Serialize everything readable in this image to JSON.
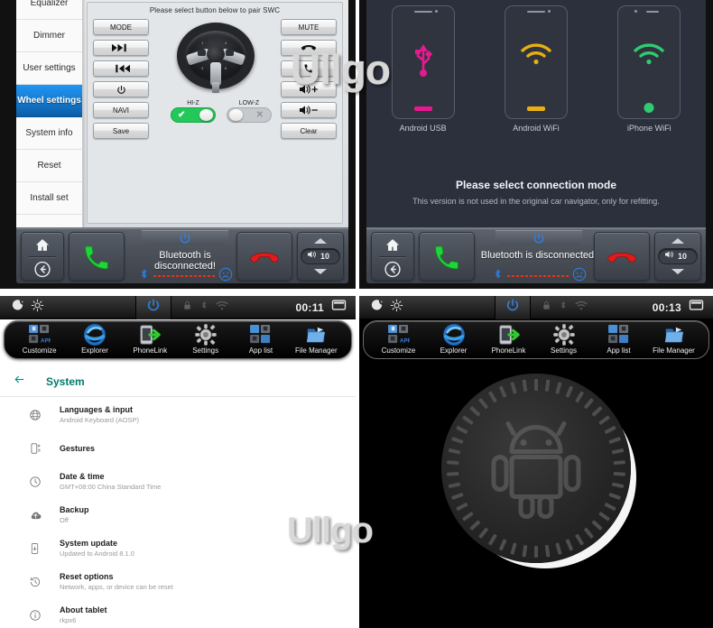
{
  "watermark": {
    "text": "Ullgo"
  },
  "panel_swc": {
    "sidebar": [
      {
        "label": "Equalizer",
        "active": false
      },
      {
        "label": "Dimmer",
        "active": false
      },
      {
        "label": "User settings",
        "active": false
      },
      {
        "label": "Wheel settings",
        "active": true
      },
      {
        "label": "System info",
        "active": false
      },
      {
        "label": "Reset",
        "active": false
      },
      {
        "label": "Install set",
        "active": false
      }
    ],
    "title": "Please select button below to pair SWC",
    "left_buttons": [
      {
        "label": "MODE",
        "icon": "text"
      },
      {
        "label": "",
        "icon": "next-track-icon"
      },
      {
        "label": "",
        "icon": "prev-track-icon"
      },
      {
        "label": "",
        "icon": "power-icon"
      },
      {
        "label": "NAVI",
        "icon": "text"
      },
      {
        "label": "Save",
        "icon": "text"
      }
    ],
    "right_buttons": [
      {
        "label": "MUTE",
        "icon": "text"
      },
      {
        "label": "",
        "icon": "call-end-icon"
      },
      {
        "label": "",
        "icon": "call-answer-icon"
      },
      {
        "label": "",
        "icon": "volume-up-icon"
      },
      {
        "label": "",
        "icon": "volume-down-icon"
      },
      {
        "label": "Clear",
        "icon": "text"
      }
    ],
    "toggles": [
      {
        "label": "HI-Z",
        "state": "on",
        "mark": "✔"
      },
      {
        "label": "LOW-Z",
        "state": "off",
        "mark": "✕"
      }
    ],
    "wheel_numbers": [
      "1",
      "4",
      "3",
      "6"
    ]
  },
  "panel_conn": {
    "phones": [
      {
        "label": "Android USB",
        "icon": "usb-icon",
        "color": "#e8188f"
      },
      {
        "label": "Android WiFi",
        "icon": "wifi-icon",
        "color": "#e8b010"
      },
      {
        "label": "iPhone WiFi",
        "icon": "wifi-icon",
        "color": "#2ecc71"
      }
    ],
    "headline": "Please select connection mode",
    "subline": "This version is not used in the original car navigator, only for refitting."
  },
  "head_unit_bar": {
    "home_icon": "home-icon",
    "back_icon": "back-icon",
    "call_icon": "call-answer-icon",
    "power_icon": "power-icon",
    "status_text": "Bluetooth is disconnected!",
    "bluetooth_icon": "bluetooth-icon",
    "sad_face_icon": "sad-face-icon",
    "hangup_icon": "call-end-icon",
    "volume_icon": "volume-icon",
    "volume_value": "10",
    "up_icon": "caret-up-icon",
    "down_icon": "caret-down-icon"
  },
  "android_left": {
    "status": {
      "night_icon": "moon-icon",
      "brightness_icon": "brightness-icon",
      "power_icon": "power-icon",
      "lock_icon": "lock-icon",
      "bt_icon": "bluetooth-icon",
      "wifi_icon": "wifi-icon",
      "clock": "00:11",
      "recents_icon": "recents-icon"
    },
    "dock": [
      {
        "label": "Customize",
        "icon": "customize-icon"
      },
      {
        "label": "Explorer",
        "icon": "explorer-icon"
      },
      {
        "label": "PhoneLink",
        "icon": "phonelink-icon"
      },
      {
        "label": "Settings",
        "icon": "gear-icon"
      },
      {
        "label": "App list",
        "icon": "applist-icon"
      },
      {
        "label": "File Manager",
        "icon": "folder-icon"
      }
    ],
    "header": {
      "back_icon": "back-arrow-icon",
      "title": "System"
    },
    "items": [
      {
        "title": "Languages & input",
        "subtitle": "Android Keyboard (AOSP)",
        "icon": "globe-icon"
      },
      {
        "title": "Gestures",
        "subtitle": "",
        "icon": "gesture-icon"
      },
      {
        "title": "Date & time",
        "subtitle": "GMT+08:00 China Standard Time",
        "icon": "clock-icon"
      },
      {
        "title": "Backup",
        "subtitle": "Off",
        "icon": "cloud-icon"
      },
      {
        "title": "System update",
        "subtitle": "Updated to Android 8.1.0",
        "icon": "device-update-icon"
      },
      {
        "title": "Reset options",
        "subtitle": "Network, apps, or device can be reset",
        "icon": "history-icon"
      },
      {
        "title": "About tablet",
        "subtitle": "rkpx6",
        "icon": "info-icon"
      }
    ]
  },
  "android_right": {
    "status": {
      "night_icon": "moon-icon",
      "brightness_icon": "brightness-icon",
      "power_icon": "power-icon",
      "lock_icon": "lock-icon",
      "bt_icon": "bluetooth-icon",
      "wifi_icon": "wifi-icon",
      "clock": "00:13",
      "recents_icon": "recents-icon"
    },
    "dock": [
      {
        "label": "Customize",
        "icon": "customize-icon"
      },
      {
        "label": "Explorer",
        "icon": "explorer-icon"
      },
      {
        "label": "PhoneLink",
        "icon": "phonelink-icon"
      },
      {
        "label": "Settings",
        "icon": "gear-icon"
      },
      {
        "label": "App list",
        "icon": "applist-icon"
      },
      {
        "label": "File Manager",
        "icon": "folder-icon"
      }
    ],
    "boot": {
      "logo": "android-oreo-icon"
    }
  }
}
